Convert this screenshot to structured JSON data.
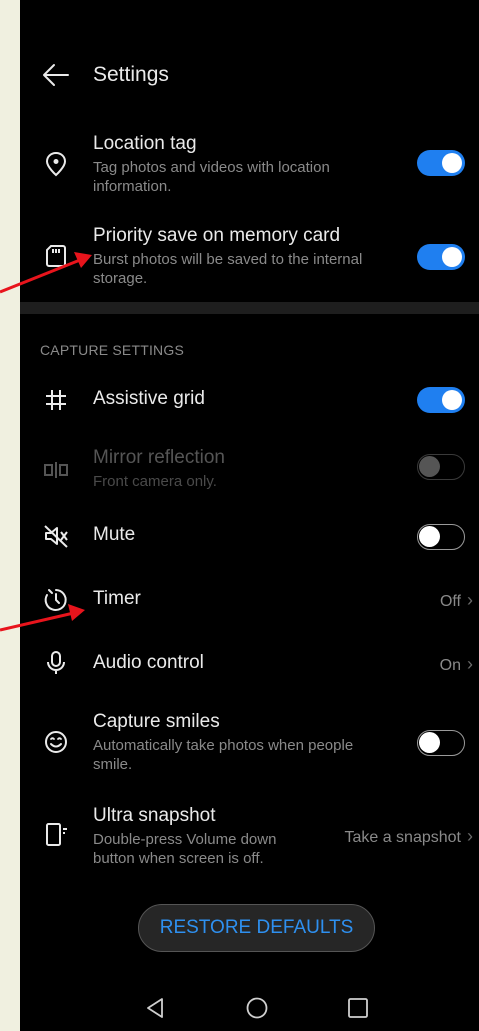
{
  "header": {
    "title": "Settings"
  },
  "rows": {
    "location_tag": {
      "label": "Location tag",
      "desc": "Tag photos and videos with location information.",
      "state": "on"
    },
    "priority_save": {
      "label": "Priority save on memory card",
      "desc": "Burst photos will be saved to the internal storage.",
      "state": "on"
    },
    "assistive_grid": {
      "label": "Assistive grid",
      "state": "on"
    },
    "mirror_reflection": {
      "label": "Mirror reflection",
      "desc": "Front camera only.",
      "state": "off-disabled"
    },
    "mute": {
      "label": "Mute",
      "state": "off"
    },
    "timer": {
      "label": "Timer",
      "value": "Off"
    },
    "audio_control": {
      "label": "Audio control",
      "value": "On"
    },
    "capture_smiles": {
      "label": "Capture smiles",
      "desc": "Automatically take photos when people smile.",
      "state": "off"
    },
    "ultra_snapshot": {
      "label": "Ultra snapshot",
      "desc": "Double-press Volume down button when screen is off.",
      "value": "Take a snapshot"
    }
  },
  "section": {
    "capture_settings": "CAPTURE SETTINGS"
  },
  "restore": {
    "label": "RESTORE DEFAULTS"
  },
  "colors": {
    "accent": "#1f7ff0",
    "background": "#000000",
    "annotation_arrow": "#e8141c",
    "page_margin": "#f0f0e0"
  },
  "icons": [
    "back-arrow-icon",
    "location-pin-icon",
    "sd-card-icon",
    "grid-icon",
    "mirror-icon",
    "mute-speaker-icon",
    "timer-icon",
    "microphone-icon",
    "smile-icon",
    "ultra-snapshot-icon",
    "nav-back-icon",
    "nav-home-icon",
    "nav-recents-icon"
  ]
}
